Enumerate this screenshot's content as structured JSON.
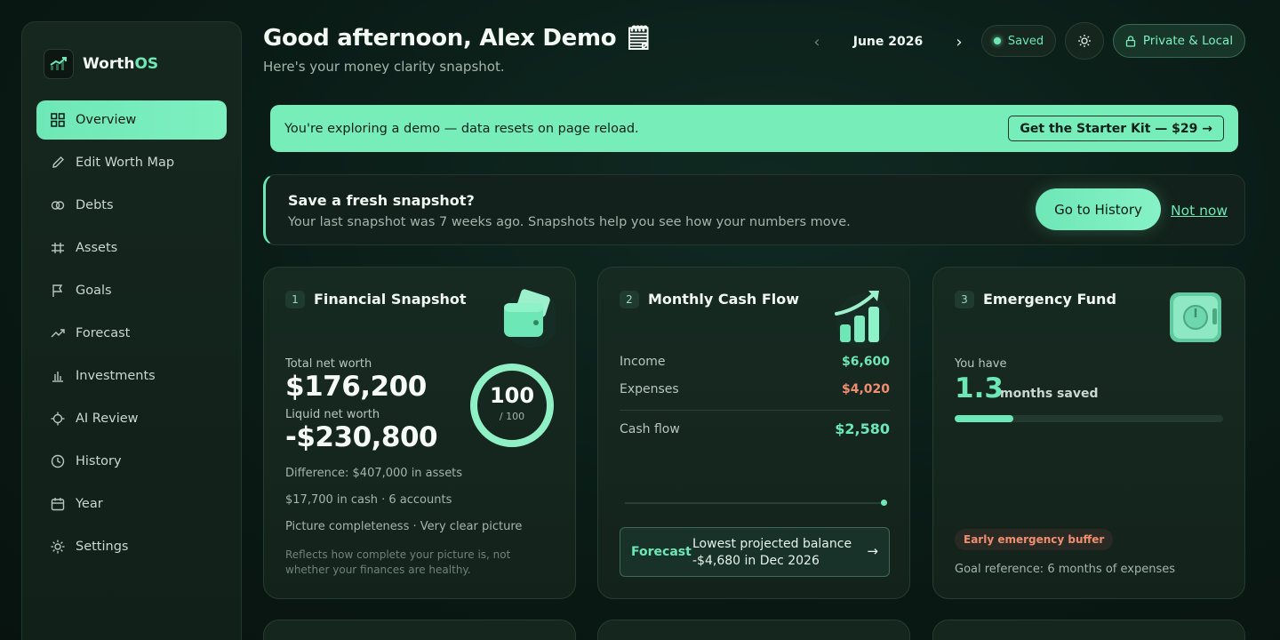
{
  "brand": {
    "name_main": "Worth",
    "name_accent": "OS"
  },
  "nav": [
    {
      "label": "Overview",
      "icon": "grid-icon",
      "active": true
    },
    {
      "label": "Edit Worth Map",
      "icon": "pencil-icon"
    },
    {
      "label": "Debts",
      "icon": "link-icon"
    },
    {
      "label": "Assets",
      "icon": "assets-icon"
    },
    {
      "label": "Goals",
      "icon": "flag-icon"
    },
    {
      "label": "Forecast",
      "icon": "trend-icon"
    },
    {
      "label": "Investments",
      "icon": "bar-chart-icon"
    },
    {
      "label": "AI Review",
      "icon": "crosshair-icon"
    },
    {
      "label": "History",
      "icon": "clock-icon"
    },
    {
      "label": "Year",
      "icon": "calendar-icon"
    },
    {
      "label": "Settings",
      "icon": "gear-icon"
    }
  ],
  "header": {
    "greeting": "Good afternoon, Alex Demo 🗒",
    "subtitle": "Here's your money clarity snapshot.",
    "month": "June 2026",
    "saved_label": "Saved",
    "privacy_label": "Private & Local"
  },
  "demo_banner": {
    "text": "You're exploring a demo — data resets on page reload.",
    "cta": "Get the Starter Kit — $29 →"
  },
  "reminder": {
    "title": "Save a fresh snapshot?",
    "subtitle": "Your last snapshot was 7 weeks ago. Snapshots help you see how your numbers move.",
    "primary": "Go to History",
    "secondary": "Not now"
  },
  "snapshot_card": {
    "number": "1",
    "title": "Financial Snapshot",
    "net_worth_label": "Total net worth",
    "net_worth": "$176,200",
    "liquid_label": "Liquid net worth",
    "liquid": "-$230,800",
    "difference": "Difference: $407,000 in assets",
    "cash": "$17,700 in cash · 6 accounts",
    "completeness": "Picture completeness · Very clear picture",
    "note": "Reflects how complete your picture is, not whether your finances are healthy.",
    "score": "100",
    "score_max": "/ 100",
    "score_fraction": 1.0
  },
  "cashflow_card": {
    "number": "2",
    "title": "Monthly Cash Flow",
    "income_label": "Income",
    "income": "$6,600",
    "expenses_label": "Expenses",
    "expenses": "$4,020",
    "cashflow_label": "Cash flow",
    "cashflow": "$2,580",
    "forecast_label": "Forecast",
    "forecast_line1": "Lowest projected balance",
    "forecast_line2": "-$4,680 in Dec 2026",
    "forecast_arrow": "→"
  },
  "emergency_card": {
    "number": "3",
    "title": "Emergency Fund",
    "you_have": "You have",
    "months": "1.3",
    "months_label": "months saved",
    "progress": 0.22,
    "badge": "Early emergency buffer",
    "goal": "Goal reference: 6 months of expenses"
  },
  "colors": {
    "accent": "#6ee7b7",
    "negative": "#f08f70",
    "background": "#0a1a15"
  }
}
